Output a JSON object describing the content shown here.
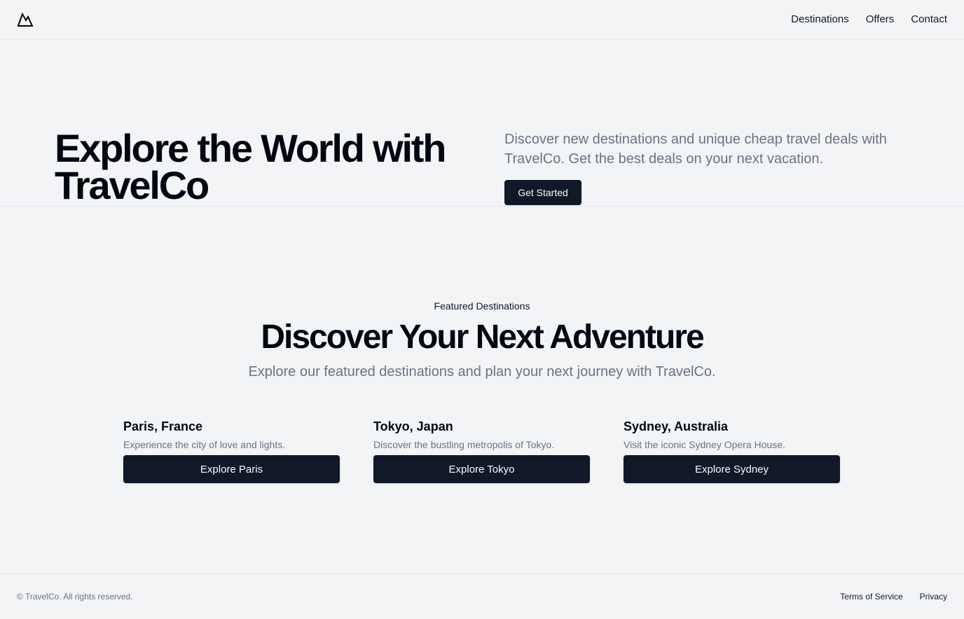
{
  "header": {
    "logo_icon": "mountain-icon",
    "nav": [
      {
        "label": "Destinations"
      },
      {
        "label": "Offers"
      },
      {
        "label": "Contact"
      }
    ]
  },
  "hero": {
    "title": "Explore the World with TravelCo",
    "description": "Discover new destinations and unique cheap travel deals with TravelCo. Get the best deals on your next vacation.",
    "cta_label": "Get Started"
  },
  "featured": {
    "label": "Featured Destinations",
    "title": "Discover Your Next Adventure",
    "subtitle": "Explore our featured destinations and plan your next journey with TravelCo.",
    "cards": [
      {
        "title": "Paris, France",
        "description": "Experience the city of love and lights.",
        "button_label": "Explore Paris"
      },
      {
        "title": "Tokyo, Japan",
        "description": "Discover the bustling metropolis of Tokyo.",
        "button_label": "Explore Tokyo"
      },
      {
        "title": "Sydney, Australia",
        "description": "Visit the iconic Sydney Opera House.",
        "button_label": "Explore Sydney"
      }
    ]
  },
  "footer": {
    "copyright": "© TravelCo. All rights reserved.",
    "links": [
      {
        "label": "Terms of Service"
      },
      {
        "label": "Privacy"
      }
    ]
  },
  "colors": {
    "background": "#f3f4f6",
    "primary": "#111827",
    "muted_text": "#6b7280",
    "border": "#e5e7eb"
  }
}
